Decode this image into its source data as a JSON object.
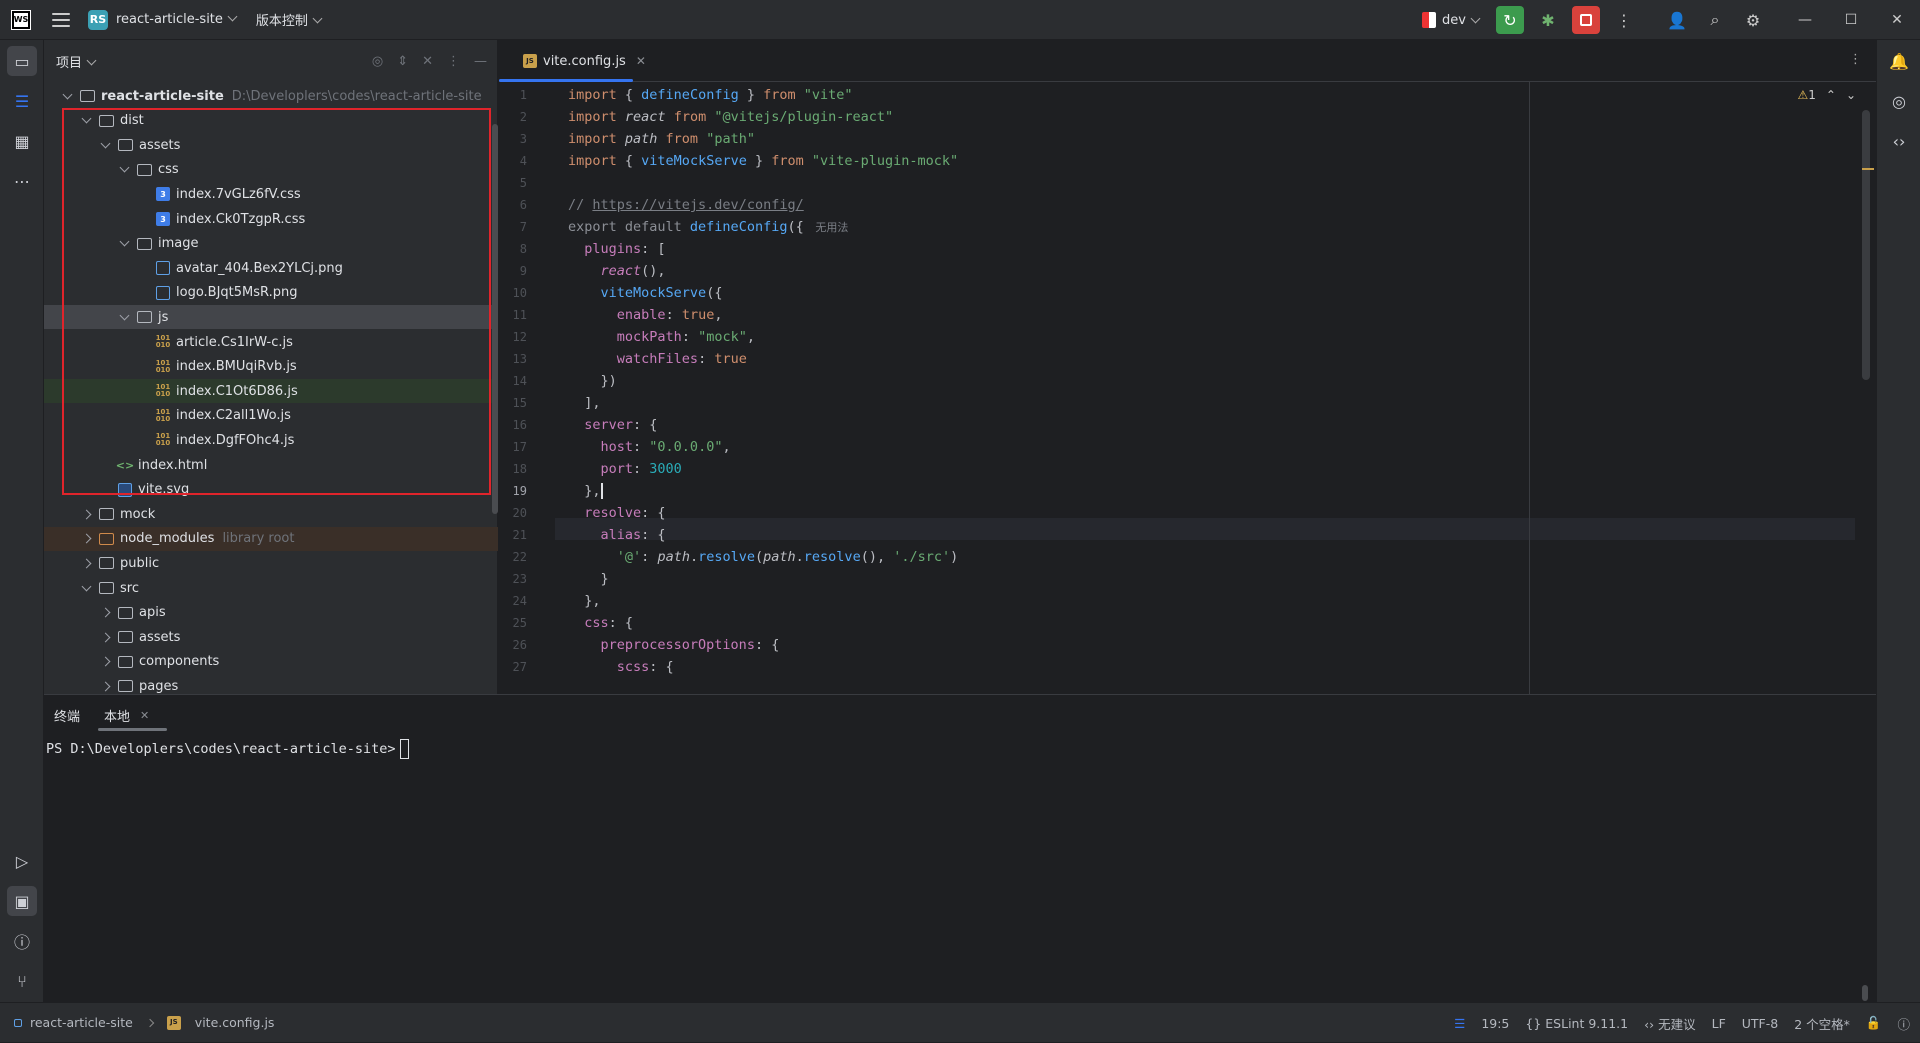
{
  "titlebar": {
    "app_logo": "WS",
    "project_badge": "RS",
    "project_name": "react-article-site",
    "vcs_label": "版本控制",
    "run_config": "dev",
    "colors": {
      "run": "#3c9b4e",
      "stop": "#d9423c",
      "accent": "#3574f0"
    }
  },
  "project_panel": {
    "title": "项目",
    "tree": [
      {
        "name": "react-article-site",
        "path": "D:\\Developlers\\codes\\react-article-site",
        "type": "folder",
        "state": "expanded",
        "level": 0
      },
      {
        "name": "dist",
        "type": "folder",
        "state": "expanded",
        "level": 1
      },
      {
        "name": "assets",
        "type": "folder",
        "state": "expanded",
        "level": 2
      },
      {
        "name": "css",
        "type": "folder",
        "state": "expanded",
        "level": 3
      },
      {
        "name": "index.7vGLz6fV.css",
        "type": "css",
        "level": 4
      },
      {
        "name": "index.Ck0TzgpR.css",
        "type": "css",
        "level": 4
      },
      {
        "name": "image",
        "type": "folder",
        "state": "expanded",
        "level": 3
      },
      {
        "name": "avatar_404.Bex2YLCj.png",
        "type": "png",
        "level": 4
      },
      {
        "name": "logo.BJqt5MsR.png",
        "type": "png",
        "level": 4
      },
      {
        "name": "js",
        "type": "folder",
        "state": "expanded",
        "level": 3,
        "selected": true
      },
      {
        "name": "article.Cs1IrW-c.js",
        "type": "js",
        "level": 4
      },
      {
        "name": "index.BMUqiRvb.js",
        "type": "js",
        "level": 4
      },
      {
        "name": "index.C1Ot6D86.js",
        "type": "js",
        "level": 4,
        "highlight": true
      },
      {
        "name": "index.C2all1Wo.js",
        "type": "js",
        "level": 4
      },
      {
        "name": "index.DgfFOhc4.js",
        "type": "js",
        "level": 4
      },
      {
        "name": "index.html",
        "type": "html",
        "level": 2
      },
      {
        "name": "vite.svg",
        "type": "svg",
        "level": 2
      },
      {
        "name": "mock",
        "type": "folder",
        "state": "collapsed",
        "level": 1
      },
      {
        "name": "node_modules",
        "note": "library root",
        "type": "libfolder",
        "state": "collapsed",
        "level": 1
      },
      {
        "name": "public",
        "type": "folder",
        "state": "collapsed",
        "level": 1
      },
      {
        "name": "src",
        "type": "folder",
        "state": "expanded",
        "level": 1
      },
      {
        "name": "apis",
        "type": "folder",
        "state": "collapsed",
        "level": 2
      },
      {
        "name": "assets",
        "type": "folder",
        "state": "collapsed",
        "level": 2
      },
      {
        "name": "components",
        "type": "folder",
        "state": "collapsed",
        "level": 2
      },
      {
        "name": "pages",
        "type": "folder",
        "state": "collapsed",
        "level": 2
      }
    ]
  },
  "editor": {
    "tab_label": "vite.config.js",
    "tab_icon": "JS",
    "warning_count": "1",
    "current_line": 19,
    "lines": [
      [
        [
          "kw",
          "import "
        ],
        [
          "p",
          "{ "
        ],
        [
          "fn",
          "defineConfig"
        ],
        [
          "p",
          " } "
        ],
        [
          "kw",
          "from "
        ],
        [
          "str",
          "\"vite\""
        ]
      ],
      [
        [
          "kw",
          "import "
        ],
        [
          "it",
          "react "
        ],
        [
          "kw",
          "from "
        ],
        [
          "str",
          "\"@vitejs/plugin-react\""
        ]
      ],
      [
        [
          "kw",
          "import "
        ],
        [
          "it",
          "path "
        ],
        [
          "kw",
          "from "
        ],
        [
          "str",
          "\"path\""
        ]
      ],
      [
        [
          "kw",
          "import "
        ],
        [
          "p",
          "{ "
        ],
        [
          "fn",
          "viteMockServe"
        ],
        [
          "p",
          " } "
        ],
        [
          "kw",
          "from "
        ],
        [
          "str",
          "\"vite-plugin-mock\""
        ]
      ],
      [],
      [
        [
          "cm",
          "// "
        ],
        [
          "url",
          "https://vitejs.dev/config/"
        ]
      ],
      [
        [
          "gr",
          "export default "
        ],
        [
          "fn",
          "defineConfig"
        ],
        [
          "p",
          "({ "
        ],
        [
          "hint",
          " 无用法"
        ]
      ],
      [
        [
          "p",
          "  "
        ],
        [
          "prop",
          "plugins"
        ],
        [
          "p",
          ": ["
        ]
      ],
      [
        [
          "p",
          "    "
        ],
        [
          "it2",
          "react"
        ],
        [
          "p",
          "(),"
        ]
      ],
      [
        [
          "p",
          "    "
        ],
        [
          "fn",
          "viteMockServe"
        ],
        [
          "p",
          "({"
        ]
      ],
      [
        [
          "p",
          "      "
        ],
        [
          "prop",
          "enable"
        ],
        [
          "p",
          ": "
        ],
        [
          "kw",
          "true"
        ],
        [
          "p",
          ","
        ]
      ],
      [
        [
          "p",
          "      "
        ],
        [
          "prop",
          "mockPath"
        ],
        [
          "p",
          ": "
        ],
        [
          "str",
          "\"mock\""
        ],
        [
          "p",
          ","
        ]
      ],
      [
        [
          "p",
          "      "
        ],
        [
          "prop",
          "watchFiles"
        ],
        [
          "p",
          ": "
        ],
        [
          "kw",
          "true"
        ]
      ],
      [
        [
          "p",
          "    })"
        ]
      ],
      [
        [
          "p",
          "  ],"
        ]
      ],
      [
        [
          "p",
          "  "
        ],
        [
          "prop",
          "server"
        ],
        [
          "p",
          ": {"
        ]
      ],
      [
        [
          "p",
          "    "
        ],
        [
          "prop",
          "host"
        ],
        [
          "p",
          ": "
        ],
        [
          "str",
          "\"0.0.0.0\""
        ],
        [
          "p",
          ","
        ]
      ],
      [
        [
          "p",
          "    "
        ],
        [
          "prop",
          "port"
        ],
        [
          "p",
          ": "
        ],
        [
          "num",
          "3000"
        ]
      ],
      [
        [
          "p",
          "  },"
        ]
      ],
      [
        [
          "p",
          "  "
        ],
        [
          "prop",
          "resolve"
        ],
        [
          "p",
          ": {"
        ]
      ],
      [
        [
          "p",
          "    "
        ],
        [
          "prop",
          "alias"
        ],
        [
          "p",
          ": {"
        ]
      ],
      [
        [
          "p",
          "      "
        ],
        [
          "str",
          "'@'"
        ],
        [
          "p",
          ": "
        ],
        [
          "it",
          "path"
        ],
        [
          "p",
          "."
        ],
        [
          "fn",
          "resolve"
        ],
        [
          "p",
          "("
        ],
        [
          "it",
          "path"
        ],
        [
          "p",
          "."
        ],
        [
          "fn",
          "resolve"
        ],
        [
          "p",
          "(), "
        ],
        [
          "str",
          "'./src'"
        ],
        [
          "p",
          ")"
        ]
      ],
      [
        [
          "p",
          "    }"
        ]
      ],
      [
        [
          "p",
          "  },"
        ]
      ],
      [
        [
          "p",
          "  "
        ],
        [
          "prop",
          "css"
        ],
        [
          "p",
          ": {"
        ]
      ],
      [
        [
          "p",
          "    "
        ],
        [
          "prop",
          "preprocessorOptions"
        ],
        [
          "p",
          ": {"
        ]
      ],
      [
        [
          "p",
          "      "
        ],
        [
          "prop",
          "scss"
        ],
        [
          "p",
          ": {"
        ]
      ]
    ],
    "colors": {
      "kw": "#cf8e6d",
      "fn": "#56a8f5",
      "str": "#6aab73",
      "prop": "#c77dbb",
      "num": "#2aacb8",
      "comment": "#7a7e85"
    }
  },
  "terminal": {
    "tab_terminal": "终端",
    "tab_local": "本地",
    "prompt": "PS D:\\Developlers\\codes\\react-article-site>"
  },
  "statusbar": {
    "crumb_project": "react-article-site",
    "crumb_file": "vite.config.js",
    "cursor": "19:5",
    "eslint": "ESLint 9.11.1",
    "suggest": "无建议",
    "line_sep": "LF",
    "encoding": "UTF-8",
    "indent": "2 个空格*"
  }
}
